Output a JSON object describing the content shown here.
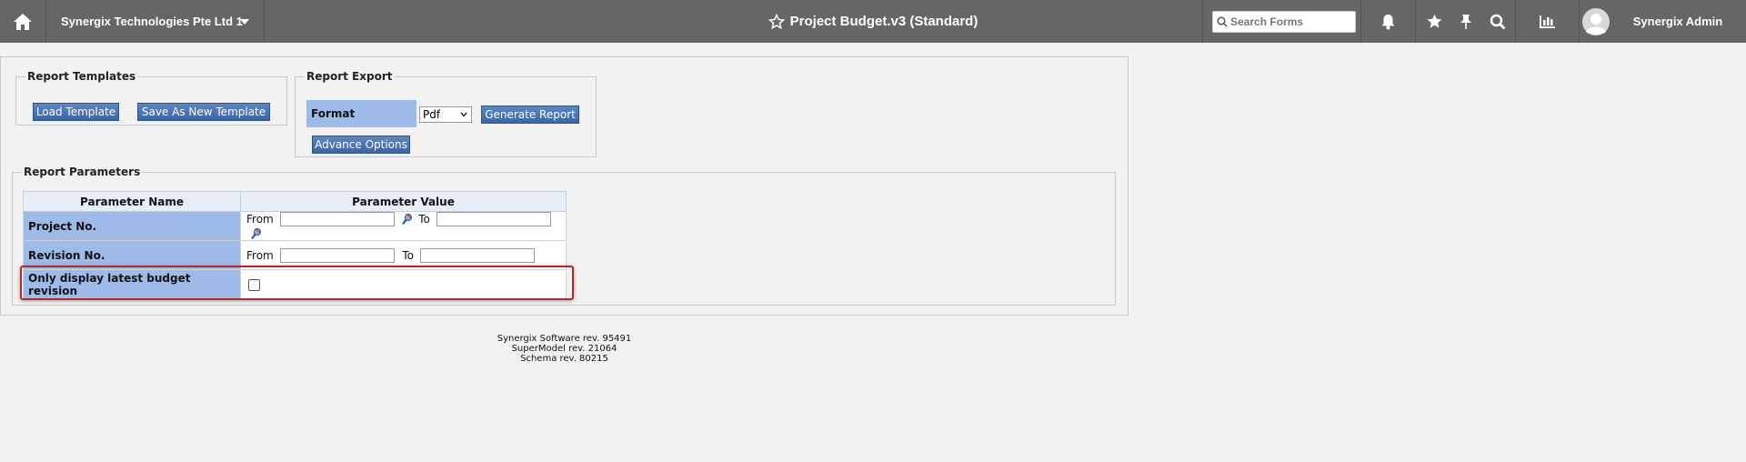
{
  "topbar": {
    "home_icon": "home-icon",
    "company": "Synergix Technologies Pte Ltd 1",
    "title": "Project Budget.v3 (Standard)",
    "search_placeholder": "Search Forms",
    "user_name": "Synergix Admin",
    "bg_color": "#666666"
  },
  "report_templates": {
    "legend": "Report Templates",
    "load_button": "Load Template",
    "save_button": "Save As New Template"
  },
  "report_export": {
    "legend": "Report Export",
    "format_label": "Format",
    "format_value": "Pdf",
    "generate_button": "Generate Report",
    "advance_button": "Advance Options"
  },
  "report_parameters": {
    "legend": "Report Parameters",
    "col_name": "Parameter Name",
    "col_value": "Parameter Value",
    "rows": [
      {
        "name": "Project No.",
        "from_label": "From",
        "to_label": "To",
        "from_value": "",
        "to_value": ""
      },
      {
        "name": "Revision No.",
        "from_label": "From",
        "to_label": "To",
        "from_value": "",
        "to_value": ""
      },
      {
        "name": "Only display latest budget revision",
        "checked": false
      }
    ]
  },
  "footer": {
    "line1": "Synergix Software rev. 95491",
    "line2": "SuperModel rev. 21064",
    "line3": "Schema rev. 80215"
  },
  "colors": {
    "button": "#3a65a6",
    "param_label_bg": "#9dbbe8",
    "highlight_border": "#b02a2a"
  }
}
